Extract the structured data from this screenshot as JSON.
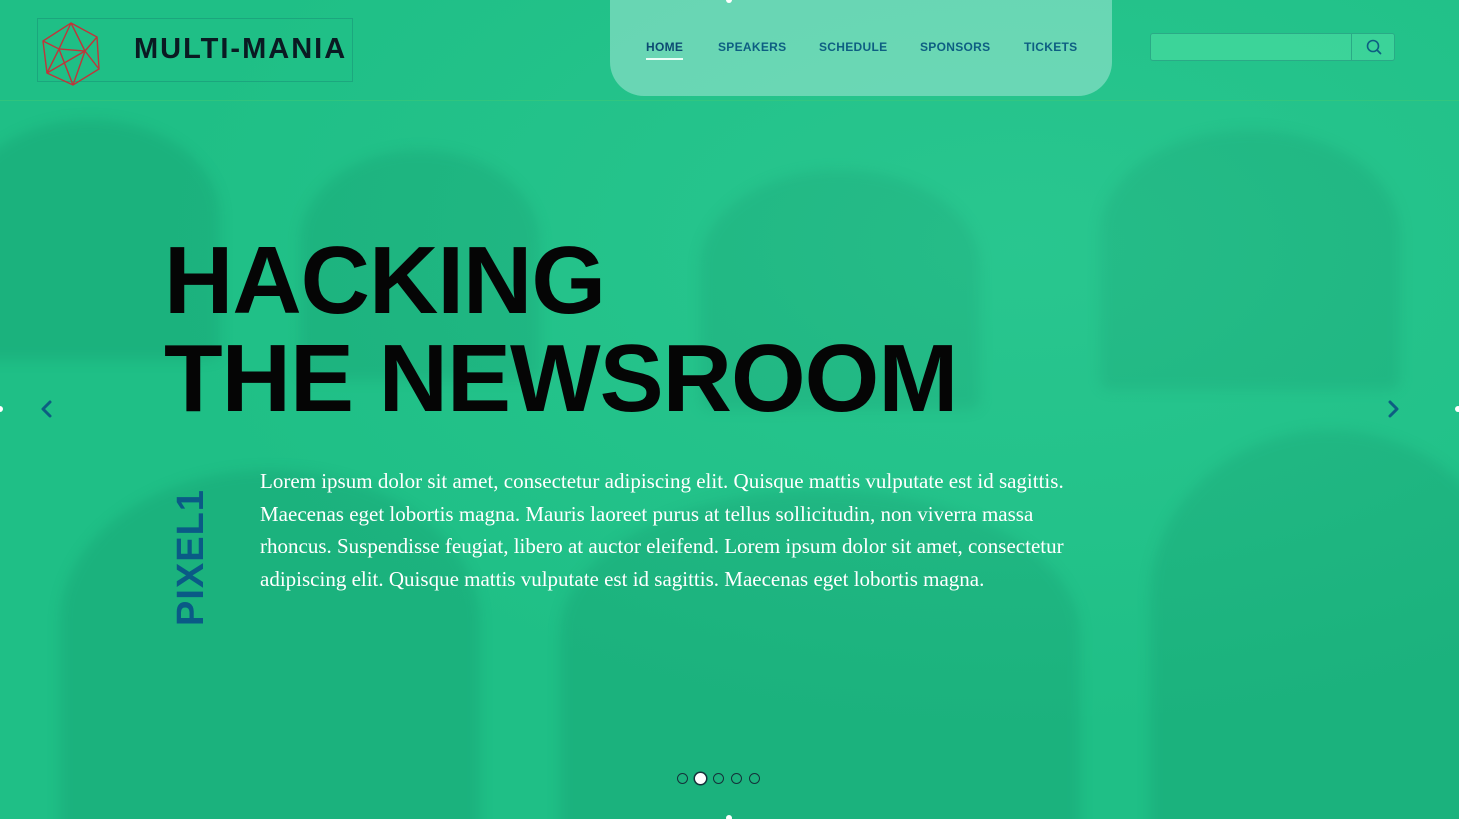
{
  "header": {
    "logo_text": "MULTI-MANIA",
    "nav": [
      {
        "label": "HOME",
        "active": true
      },
      {
        "label": "SPEAKERS",
        "active": false
      },
      {
        "label": "SCHEDULE",
        "active": false
      },
      {
        "label": "SPONSORS",
        "active": false
      },
      {
        "label": "TICKETS",
        "active": false
      }
    ],
    "search": {
      "value": "",
      "placeholder": "",
      "icon": "search-icon"
    }
  },
  "hero": {
    "headline_line1": "HACKING",
    "headline_line2": "THE NEWSROOM",
    "side_label": "PIXEL1",
    "body": "Lorem ipsum dolor sit amet, consectetur adipiscing elit. Quisque mattis vulputate est id sagittis. Maecenas eget lobortis magna. Mauris laoreet purus at tellus sollicitudin, non viverra massa rhoncus. Suspendisse feugiat, libero at auctor eleifend. Lorem ipsum dolor sit amet, consectetur adipiscing elit. Quisque mattis vulputate est id sagittis. Maecenas eget lobortis magna.",
    "prev_icon": "chevron-left-icon",
    "next_icon": "chevron-right-icon"
  },
  "slider": {
    "slide_count": 5,
    "active_index": 1
  },
  "colors": {
    "background": "#1fbf86",
    "headline": "#050505",
    "nav_text": "#0d5e82",
    "side_label": "#0a5a86",
    "logo_mark": "#c0353a"
  }
}
